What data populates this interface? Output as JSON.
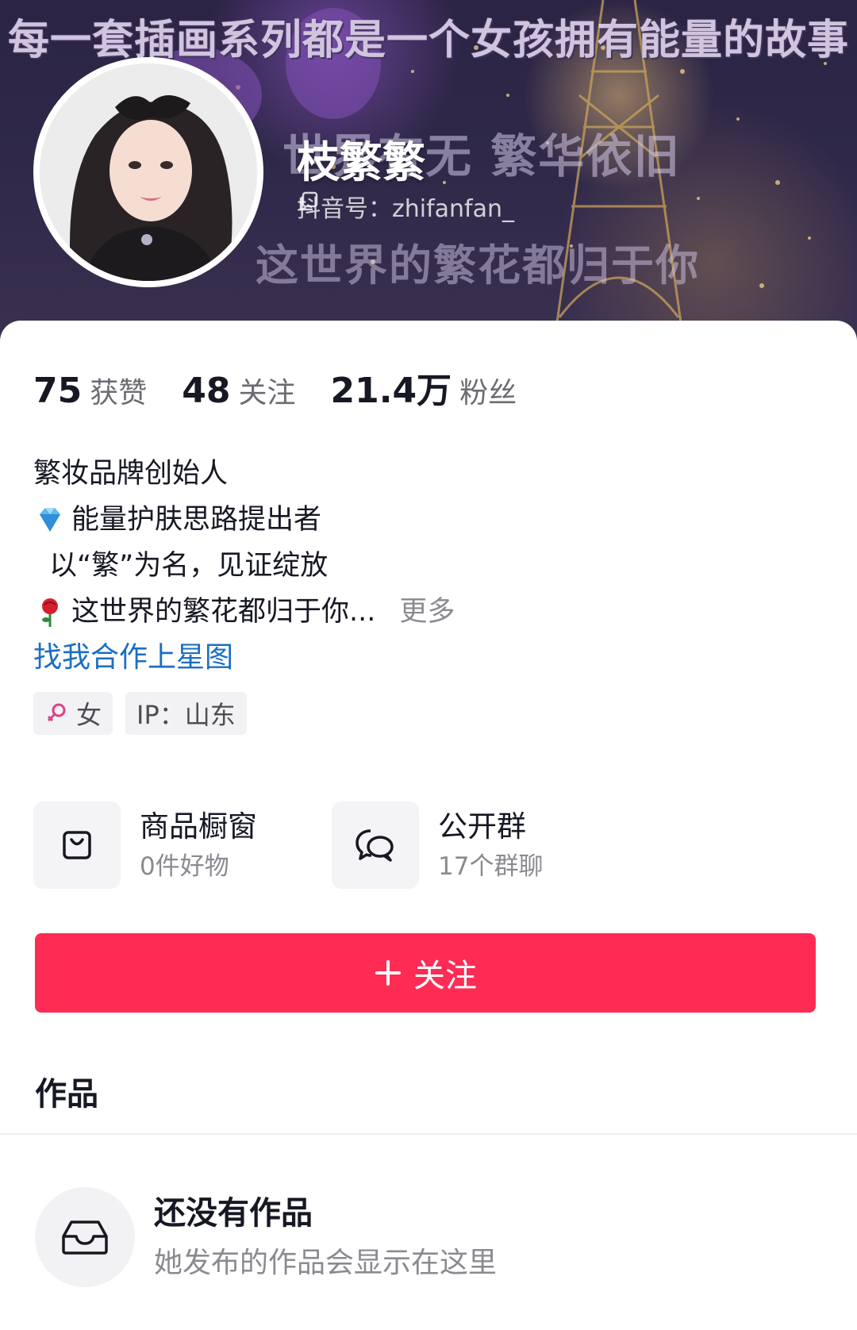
{
  "banner": {
    "headline": "每一套插画系列都是一个女孩拥有能量的故事",
    "line2": "世界有无 繁华依旧",
    "line3": "这世界的繁花都归于你"
  },
  "profile": {
    "name": "枝繁繁",
    "douyin_id": "抖音号：zhifanfan_",
    "avatar_icon": "avatar-photo"
  },
  "stats": [
    {
      "value": "75",
      "label": "获赞"
    },
    {
      "value": "48",
      "label": "关注"
    },
    {
      "value": "21.4万",
      "label": "粉丝"
    }
  ],
  "bio": {
    "line1": "繁妆品牌创始人",
    "line2": "能量护肤思路提出者",
    "line3": "以“繁”为名，见证绽放",
    "line4": "这世界的繁花都归于你...",
    "more": "更多",
    "link": "找我合作上星图",
    "emoji2": "gem-icon",
    "emoji4": "rose-icon"
  },
  "tags": {
    "gender": "女",
    "ip": "IP：山东"
  },
  "features": [
    {
      "title": "商品橱窗",
      "sub": "0件好物",
      "icon": "shopping-bag-icon"
    },
    {
      "title": "公开群",
      "sub": "17个群聊",
      "icon": "chat-bubbles-icon"
    }
  ],
  "actions": {
    "follow_label": "关注"
  },
  "works": {
    "tab": "作品",
    "empty_title": "还没有作品",
    "empty_sub": "她发布的作品会显示在这里"
  },
  "colors": {
    "accent": "#fe2c55",
    "link": "#1b6ec2",
    "gender": "#e0408a"
  }
}
